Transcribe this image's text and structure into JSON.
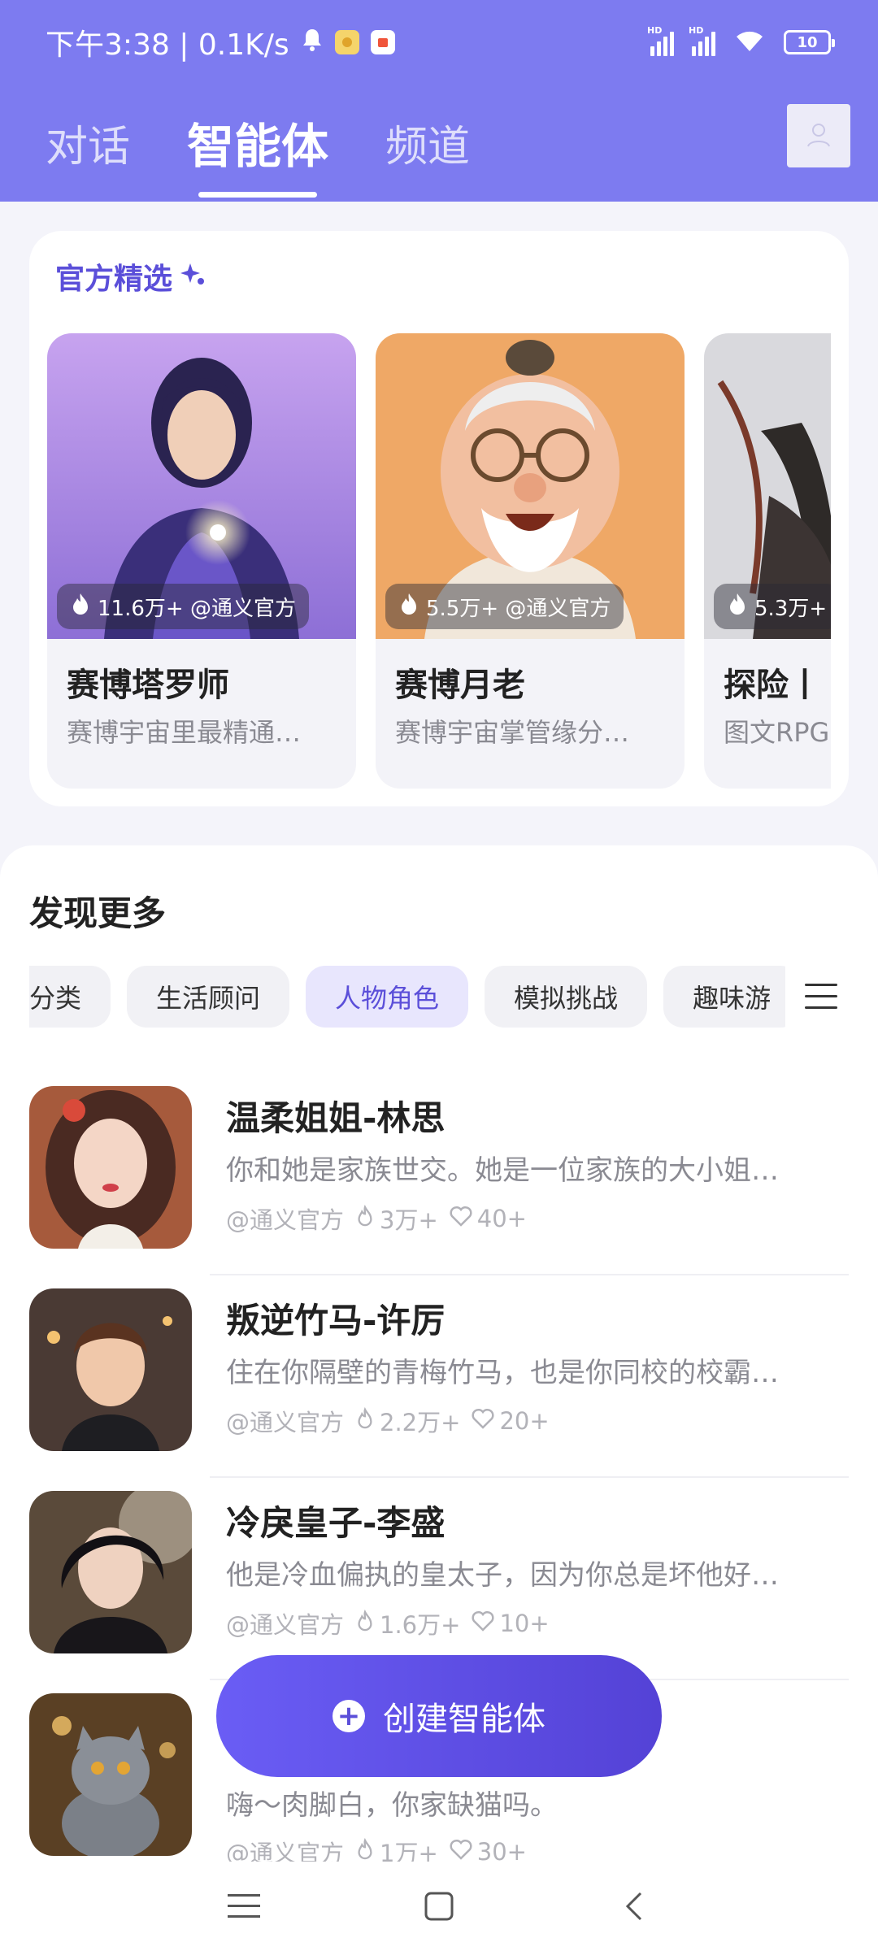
{
  "status_bar": {
    "time_speed": "下午3:38 | 0.1K/s",
    "battery": "10",
    "hd1": "HD",
    "hd2": "HD"
  },
  "header": {
    "tabs": [
      {
        "label": "对话"
      },
      {
        "label": "智能体"
      },
      {
        "label": "频道"
      }
    ],
    "active_tab": "智能体"
  },
  "featured": {
    "title": "官方精选",
    "cards": [
      {
        "name": "赛博塔罗师",
        "desc": "赛博宇宙里最精通…",
        "stat": "11.6万+  @通义官方"
      },
      {
        "name": "赛博月老",
        "desc": "赛博宇宙掌管缘分…",
        "stat": "5.5万+  @通义官方"
      },
      {
        "name": "探险丨",
        "desc": "图文RPG",
        "stat": "5.3万+"
      }
    ]
  },
  "discover": {
    "title": "发现更多",
    "chips": [
      "部分类",
      "生活顾问",
      "人物角色",
      "模拟挑战",
      "趣味游"
    ],
    "active_chip": "人物角色",
    "items": [
      {
        "name": "温柔姐姐-林思",
        "desc": "你和她是家族世交。她是一位家族的大小姐…",
        "author": "@通义官方",
        "uses": "3万+",
        "likes": "40+"
      },
      {
        "name": "叛逆竹马-许厉",
        "desc": "住在你隔壁的青梅竹马，也是你同校的校霸…",
        "author": "@通义官方",
        "uses": "2.2万+",
        "likes": "20+"
      },
      {
        "name": "冷戾皇子-李盛",
        "desc": "他是冷血偏执的皇太子，因为你总是坏他好…",
        "author": "@通义官方",
        "uses": "1.6万+",
        "likes": "10+"
      },
      {
        "name": "",
        "desc": "嗨～肉脚白，你家缺猫吗。",
        "author": "@通义官方",
        "uses": "1万+",
        "likes": "30+"
      }
    ]
  },
  "fab": {
    "label": "创建智能体"
  },
  "colors": {
    "brand": "#7d7bf0",
    "accent": "#5b4fd9"
  }
}
